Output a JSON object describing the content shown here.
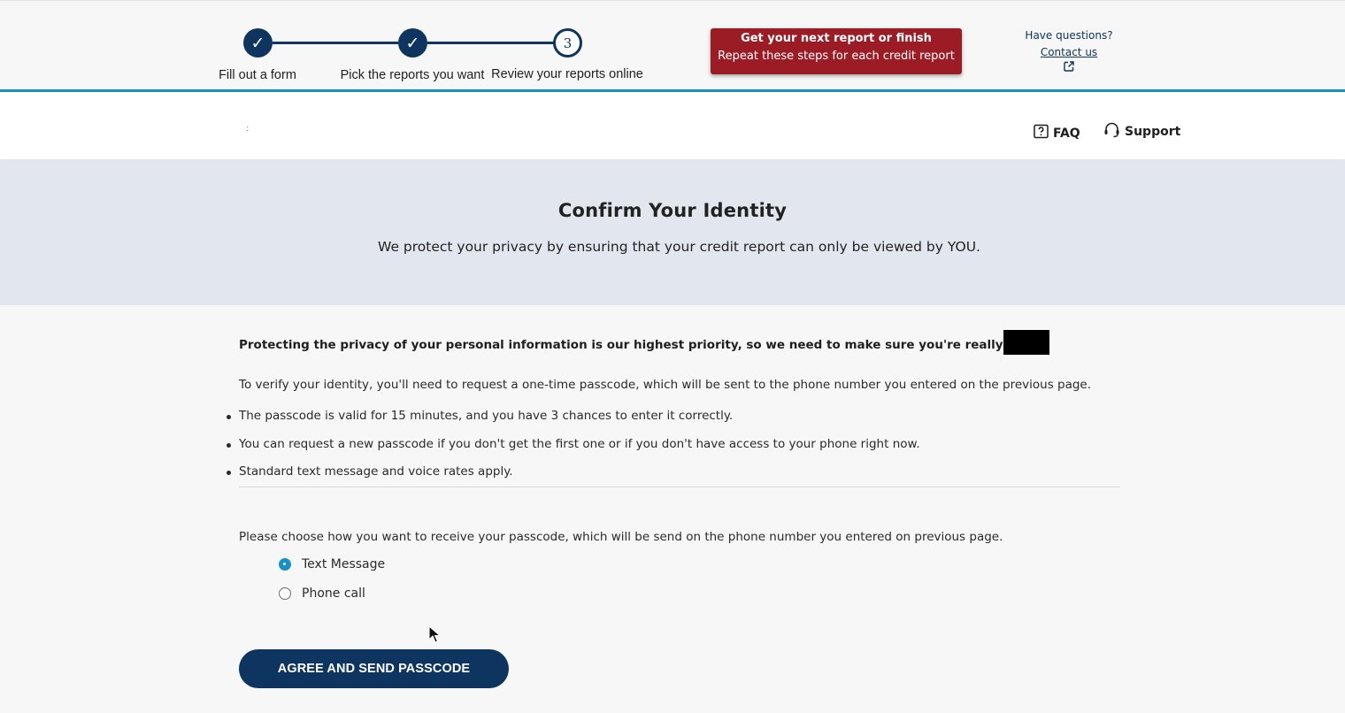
{
  "stepper": {
    "steps": [
      {
        "label": "Fill out a form",
        "status": "complete",
        "marker": "✓"
      },
      {
        "label": "Pick the reports you want",
        "status": "complete",
        "marker": "✓"
      },
      {
        "label": "Review your reports online",
        "status": "current",
        "marker": "3"
      }
    ]
  },
  "next_report_banner": {
    "title": "Get your next report or finish",
    "subtitle": "Repeat these steps for each credit report"
  },
  "questions": {
    "prompt": "Have questions?",
    "contact_link": "Contact us",
    "external_icon": "external-link-icon"
  },
  "header": {
    "faq_label": "FAQ",
    "faq_icon": "question-mark-box-icon",
    "support_label": "Support",
    "support_icon": "headset-icon",
    "dot": ":"
  },
  "hero": {
    "title": "Confirm Your Identity",
    "subtitle": "We protect your privacy by ensuring that your credit report can only be viewed by YOU."
  },
  "content": {
    "priority_text": "Protecting the privacy of your personal information is our highest priority, so we need to make sure you're really",
    "intro_text": "To verify your identity, you'll need to request a one-time passcode, which will be sent to the phone number you entered on the previous page.",
    "bullets": [
      "The passcode is valid for 15 minutes, and you have 3 chances to enter it correctly.",
      "You can request a new passcode if you don't get the first one or if you don't have access to your phone right now.",
      "Standard text message and voice rates apply."
    ],
    "choose_text": "Please choose how you want to receive your passcode, which will be send on the phone number you entered on previous page.",
    "options": [
      {
        "label": "Text Message",
        "selected": true
      },
      {
        "label": "Phone call",
        "selected": false
      }
    ],
    "submit_label": "AGREE AND SEND PASSCODE"
  },
  "colors": {
    "navy": "#0e3460",
    "accent_blue": "#1a8fc4",
    "banner_red": "#9b1c24",
    "hero_bg": "#e2e7ef"
  }
}
